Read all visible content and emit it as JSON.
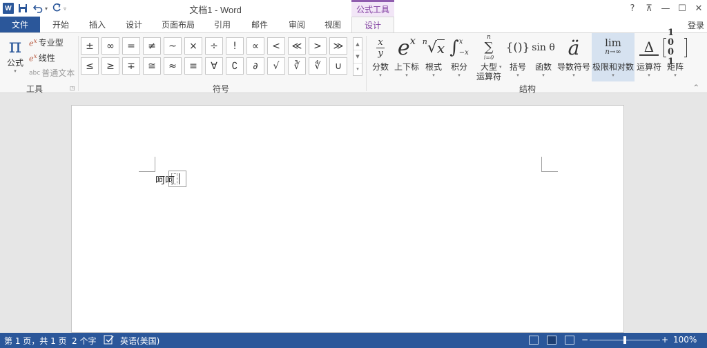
{
  "qat": {
    "app_icon_letter": "W"
  },
  "title": "文档1 - Word",
  "contextual": {
    "label": "公式工具"
  },
  "window": {
    "help": "?",
    "restore_ribbon": "⊼",
    "minimize": "—",
    "maximize": "☐",
    "close": "✕"
  },
  "tabs": [
    "文件",
    "开始",
    "插入",
    "设计",
    "页面布局",
    "引用",
    "邮件",
    "审阅",
    "视图",
    "设计"
  ],
  "login": "登录",
  "tools_group": {
    "label": "工具",
    "equation": "公式",
    "pi": "π",
    "professional": "专业型",
    "linear": "线性",
    "normal_text": "普通文本",
    "normal_text_prefix": "abc"
  },
  "symbols_group": {
    "label": "符号",
    "row1": [
      "±",
      "∞",
      "=",
      "≠",
      "~",
      "×",
      "÷",
      "!",
      "∝",
      "<",
      "≪",
      ">",
      "≫"
    ],
    "row2": [
      "≤",
      "≥",
      "∓",
      "≅",
      "≈",
      "≡",
      "∀",
      "∁",
      "∂",
      "√",
      "∛",
      "∜",
      "∪"
    ]
  },
  "structures_group": {
    "label": "结构",
    "items": [
      {
        "label": "分数"
      },
      {
        "label": "上下标"
      },
      {
        "label": "根式"
      },
      {
        "label": "积分"
      },
      {
        "label": "大型",
        "label2": "运算符"
      },
      {
        "label": "括号"
      },
      {
        "label": "函数"
      },
      {
        "label": "导数符号"
      },
      {
        "label": "极限和对数"
      },
      {
        "label": "运算符"
      },
      {
        "label": "矩阵"
      }
    ],
    "glyphs": {
      "fraction_num": "x",
      "fraction_den": "y",
      "script_base": "e",
      "script_sup": "x",
      "radical_index": "n",
      "radical_sym": "√",
      "radical_base": "x",
      "integral_sym": "∫",
      "integral_upper": "x",
      "integral_lower": "−x",
      "largeop_upper": "n",
      "largeop_sym": "∑",
      "largeop_lower": "i=0",
      "bracket": "{()}",
      "function": "sin θ",
      "accent": "ä",
      "limit_top": "lim",
      "limit_bottom": "n→∞",
      "operator_top": "Δ",
      "matrix_row1": "1 0",
      "matrix_row2": "0 1"
    }
  },
  "document": {
    "text": "呵呵"
  },
  "status": {
    "page": "第 1 页，共 1 页",
    "words": "2 个字",
    "language": "英语(美国)",
    "zoom_out": "−",
    "zoom_in": "+",
    "zoom_level": "100%",
    "zoom_fraction": 0.5
  },
  "colors": {
    "word_blue": "#2b579a",
    "context_purple": "#7f3b9f",
    "highlight": "#d6e2f0"
  }
}
